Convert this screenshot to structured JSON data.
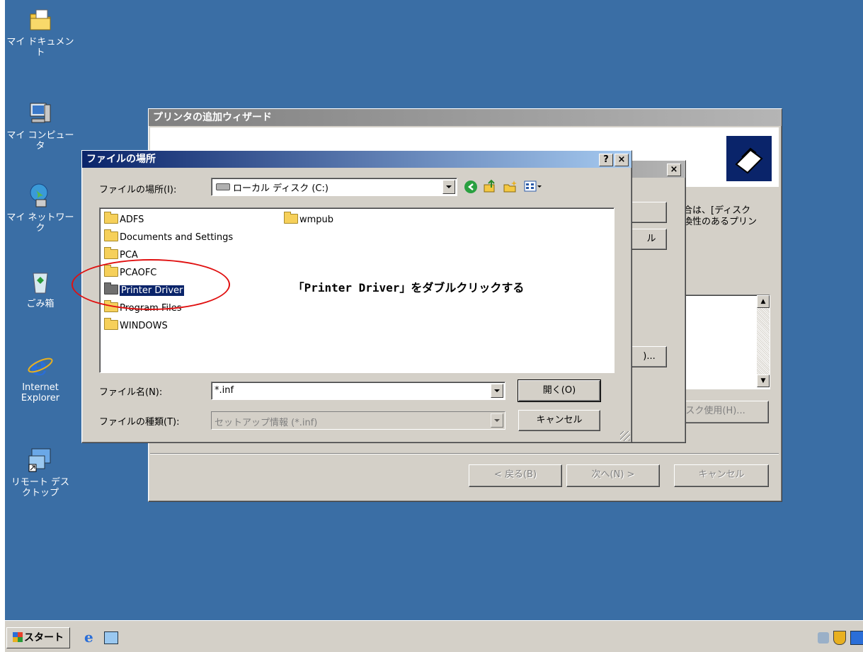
{
  "desktop": {
    "icons": [
      {
        "label": "マイ ドキュメント",
        "icon": "my-documents-icon"
      },
      {
        "label": "マイ コンピュータ",
        "icon": "my-computer-icon"
      },
      {
        "label": "マイ ネットワーク",
        "icon": "my-network-icon"
      },
      {
        "label": "ごみ箱",
        "icon": "recycle-bin-icon"
      },
      {
        "label": "Internet Explorer",
        "icon": "internet-explorer-icon"
      },
      {
        "label": "リモート デスクトップ",
        "icon": "remote-desktop-icon"
      }
    ]
  },
  "wizard": {
    "title": "プリンタの追加ウィザード",
    "desc_line1": "合は、[ディスク",
    "desc_line2": "換性のあるプリン",
    "disk_button": "ディスク使用(H)...",
    "back_button": "< 戻る(B)",
    "next_button": "次へ(N) >",
    "cancel_button": "キャンセル"
  },
  "middle_dialog": {
    "btn_label_2": "ル",
    "btn_label_3": ")..."
  },
  "file_dialog": {
    "title": "ファイルの場所",
    "help_glyph": "?",
    "close_glyph": "×",
    "location_label": "ファイルの場所(I):",
    "location_value": "ローカル ディスク (C:)",
    "folders": [
      "ADFS",
      "Documents and Settings",
      "PCA",
      "PCAOFC",
      "Printer Driver",
      "Program Files",
      "WINDOWS",
      "wmpub"
    ],
    "selected_folder": "Printer Driver",
    "filename_label": "ファイル名(N):",
    "filename_value": "*.inf",
    "filetype_label": "ファイルの種類(T):",
    "filetype_value": "セットアップ情報 (*.inf)",
    "open_button": "開く(O)",
    "cancel_button": "キャンセル"
  },
  "annotation": {
    "text": "「Printer Driver」をダブルクリックする",
    "color": "#e01010"
  },
  "taskbar": {
    "start_label": "スタート"
  },
  "colors": {
    "desktop": "#3a6ea5",
    "active_title": "#0a246a",
    "window_face": "#d4d0c8"
  }
}
